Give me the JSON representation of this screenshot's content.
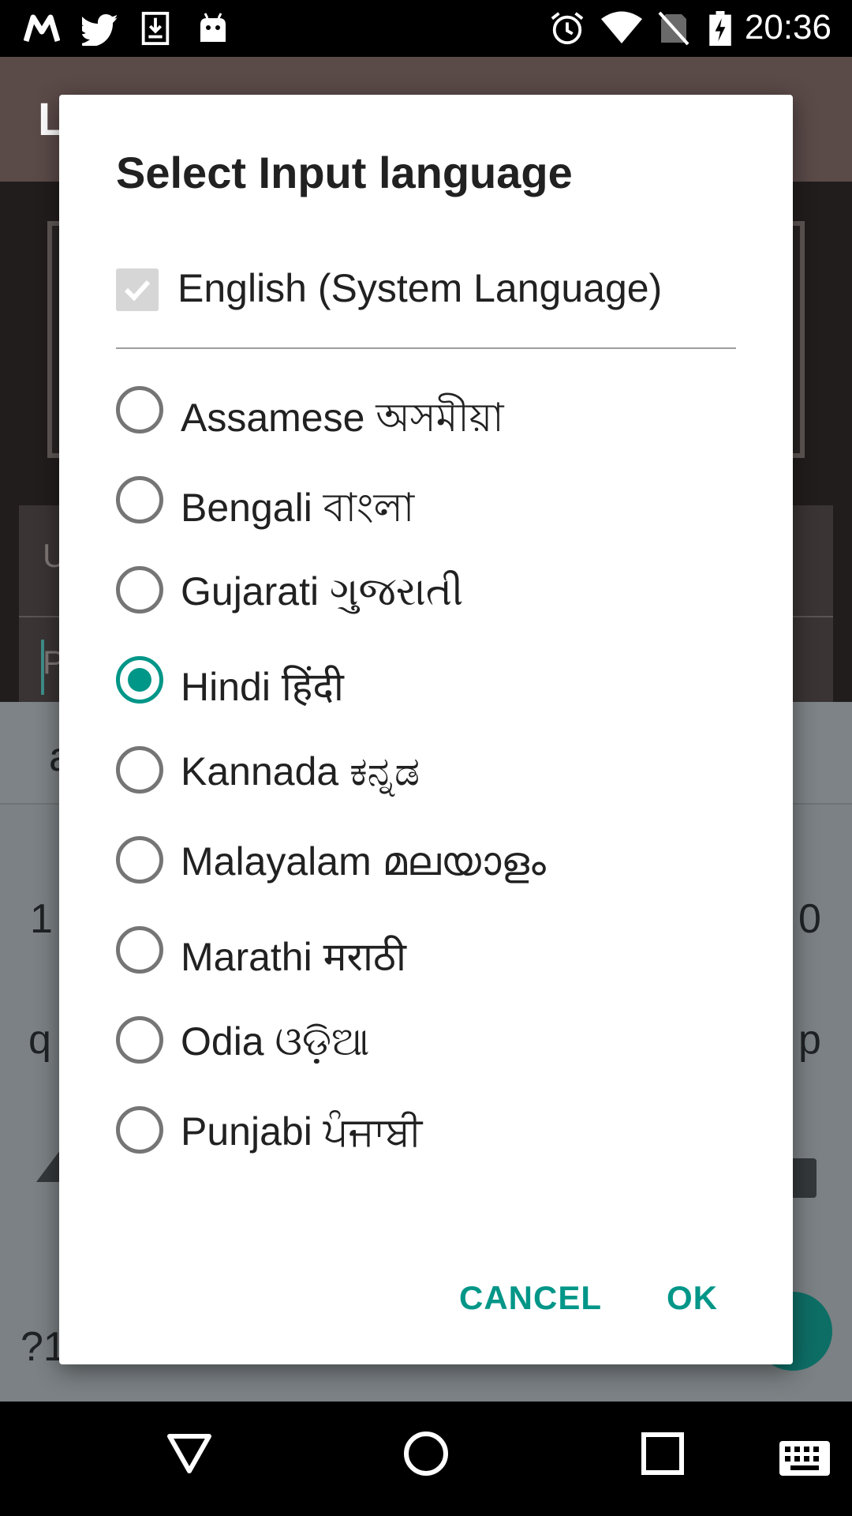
{
  "status_bar": {
    "time": "20:36",
    "left_icons": [
      "gmail-m-icon",
      "twitter-bird-icon",
      "download-icon",
      "android-icon"
    ],
    "right_icons": [
      "alarm-icon",
      "wifi-icon",
      "no-sim-icon",
      "battery-charging-icon"
    ]
  },
  "background_app": {
    "title_partial": "L",
    "field_label_partial": "U",
    "field_text_partial": "P",
    "keyboard_keys": {
      "row_num_left": "1",
      "row_num_right": "0",
      "row_q": "q",
      "row_p": "p",
      "sugg_left": "a",
      "symbols": "?1"
    }
  },
  "dialog": {
    "title": "Select Input language",
    "system_language": {
      "label": "English (System Language)",
      "checked": true
    },
    "languages": [
      {
        "label": "Assamese অসমীয়া",
        "selected": false
      },
      {
        "label": "Bengali বাংলা",
        "selected": false
      },
      {
        "label": "Gujarati ગુજરાતી",
        "selected": false
      },
      {
        "label": "Hindi हिंदी",
        "selected": true
      },
      {
        "label": "Kannada ಕನ್ನಡ",
        "selected": false
      },
      {
        "label": "Malayalam മലയാളം",
        "selected": false
      },
      {
        "label": "Marathi मराठी",
        "selected": false
      },
      {
        "label": "Odia ଓଡ଼ିଆ",
        "selected": false
      },
      {
        "label": "Punjabi ਪੰਜਾਬੀ",
        "selected": false
      }
    ],
    "cancel_label": "CANCEL",
    "ok_label": "OK",
    "accent_color": "#009688"
  },
  "nav_bar": {
    "icons": [
      "back-icon",
      "home-icon",
      "recents-icon",
      "keyboard-icon"
    ]
  }
}
